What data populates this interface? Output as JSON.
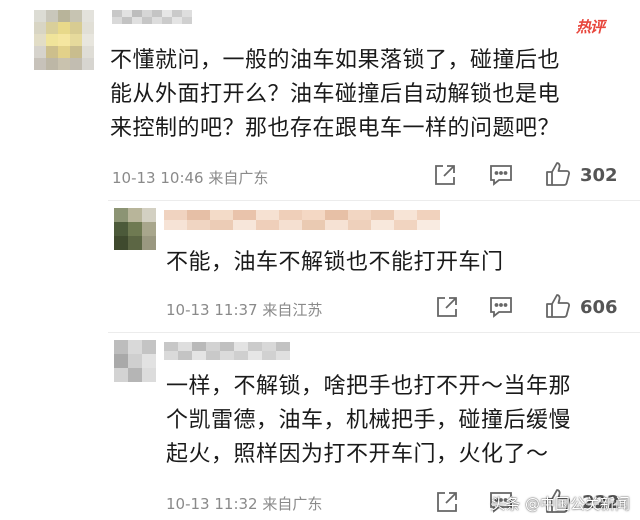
{
  "comments": [
    {
      "hot_label": "热评",
      "lines": [
        "不懂就问，一般的油车如果落锁了，碰撞后也",
        "能从外面打开么？油车碰撞后自动解锁也是电",
        "来控制的吧？那也存在跟电车一样的问题吧？"
      ],
      "meta": "10-13 10:46 来自广东",
      "likes": "302"
    },
    {
      "lines": [
        "不能，油车不解锁也不能打开车门"
      ],
      "meta": "10-13 11:37 来自江苏",
      "likes": "606"
    },
    {
      "lines": [
        "一样，不解锁，啥把手也打不开～当年那",
        "个凯雷德，油车，机械把手，碰撞后缓慢",
        "起火，照样因为打不开车门，火化了～"
      ],
      "meta": "10-13 11:32 来自广东",
      "likes": "222"
    }
  ],
  "watermark": "头条 @中国公关新闻",
  "icons": {
    "share": "share-icon",
    "reply": "reply-icon",
    "like": "like-icon"
  },
  "colors": {
    "hot": "#e8463c",
    "meta": "#8a8a8a",
    "text": "#1a1a1a"
  }
}
